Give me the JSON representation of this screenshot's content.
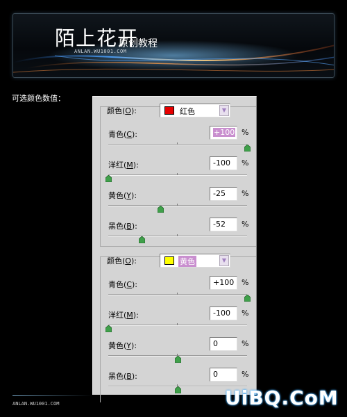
{
  "banner": {
    "title": "陌上花开",
    "subtitle": "原创教程",
    "url": "ANLAN.WU1001.COM"
  },
  "section_label": "可选颜色数值：",
  "groups": [
    {
      "color_label_prefix": "颜色(",
      "color_label_key": "O",
      "color_label_suffix": "):",
      "selected_color": "红色",
      "swatch_color": "#e60000",
      "sliders": [
        {
          "label_prefix": "青色(",
          "key": "C",
          "label_suffix": "):",
          "value": "+100",
          "pct": "%",
          "level": 100
        },
        {
          "label_prefix": "洋红(",
          "key": "M",
          "label_suffix": "):",
          "value": "-100",
          "pct": "%",
          "level": -100
        },
        {
          "label_prefix": "黄色(",
          "key": "Y",
          "label_suffix": "):",
          "value": "-25",
          "pct": "%",
          "level": -25
        },
        {
          "label_prefix": "黑色(",
          "key": "B",
          "label_suffix": "):",
          "value": "-52",
          "pct": "%",
          "level": -52
        }
      ]
    },
    {
      "color_label_prefix": "颜色(",
      "color_label_key": "O",
      "color_label_suffix": "):",
      "selected_color": "黄色",
      "swatch_color": "#ffff00",
      "sliders": [
        {
          "label_prefix": "青色(",
          "key": "C",
          "label_suffix": "):",
          "value": "+100",
          "pct": "%",
          "level": 100
        },
        {
          "label_prefix": "洋红(",
          "key": "M",
          "label_suffix": "):",
          "value": "-100",
          "pct": "%",
          "level": -100
        },
        {
          "label_prefix": "黄色(",
          "key": "Y",
          "label_suffix": "):",
          "value": "0",
          "pct": "%",
          "level": 0
        },
        {
          "label_prefix": "黑色(",
          "key": "B",
          "label_suffix": "):",
          "value": "0",
          "pct": "%",
          "level": 0
        }
      ]
    }
  ],
  "footer": {
    "url": "ANLAN.WU1001.COM",
    "watermark": "UiBQ.CoM"
  }
}
